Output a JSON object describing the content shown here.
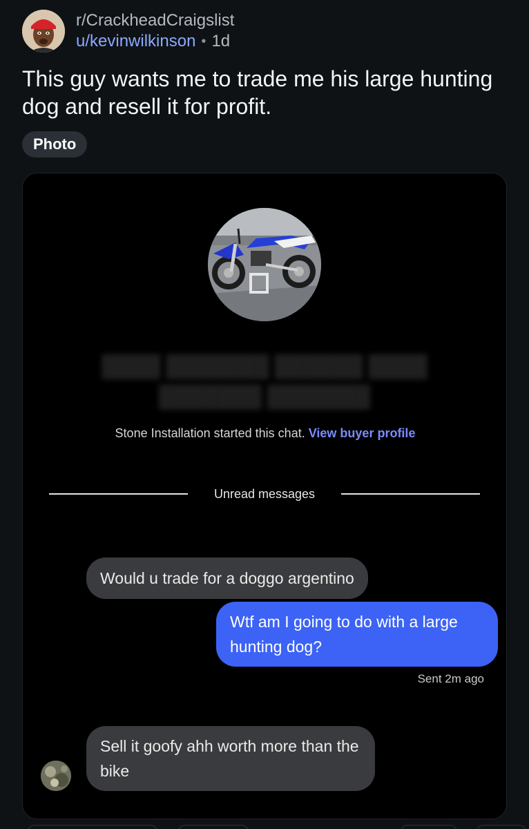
{
  "post": {
    "subreddit": "r/CrackheadCraigslist",
    "username": "u/kevinwilkinson",
    "separator": "•",
    "age": "1d",
    "title": "This guy wants me to trade me his large hunting dog and resell it for profit.",
    "flair": "Photo"
  },
  "chat": {
    "started_text": "Stone Installation started this chat.",
    "view_profile_link": "View buyer profile",
    "divider_label": "Unread messages",
    "messages": [
      {
        "direction": "incoming",
        "text": "Would u trade for a doggo argentino"
      },
      {
        "direction": "outgoing",
        "text": "Wtf am I going to do with a large hunting dog?"
      },
      {
        "direction": "incoming",
        "text": "Sell it goofy ahh worth more than the bike"
      }
    ],
    "sent_status": "Sent 2m ago"
  },
  "colors": {
    "background": "#0f1215",
    "link": "#8aa9ff",
    "outgoing_bubble": "#3c63f5",
    "incoming_bubble": "#3a3b3e",
    "chat_link": "#7b8cff"
  },
  "icons": {
    "subreddit_avatar": "subreddit-avatar",
    "listing_photo": "dirt-bike-photo",
    "sender_avatar": "sender-avatar"
  }
}
